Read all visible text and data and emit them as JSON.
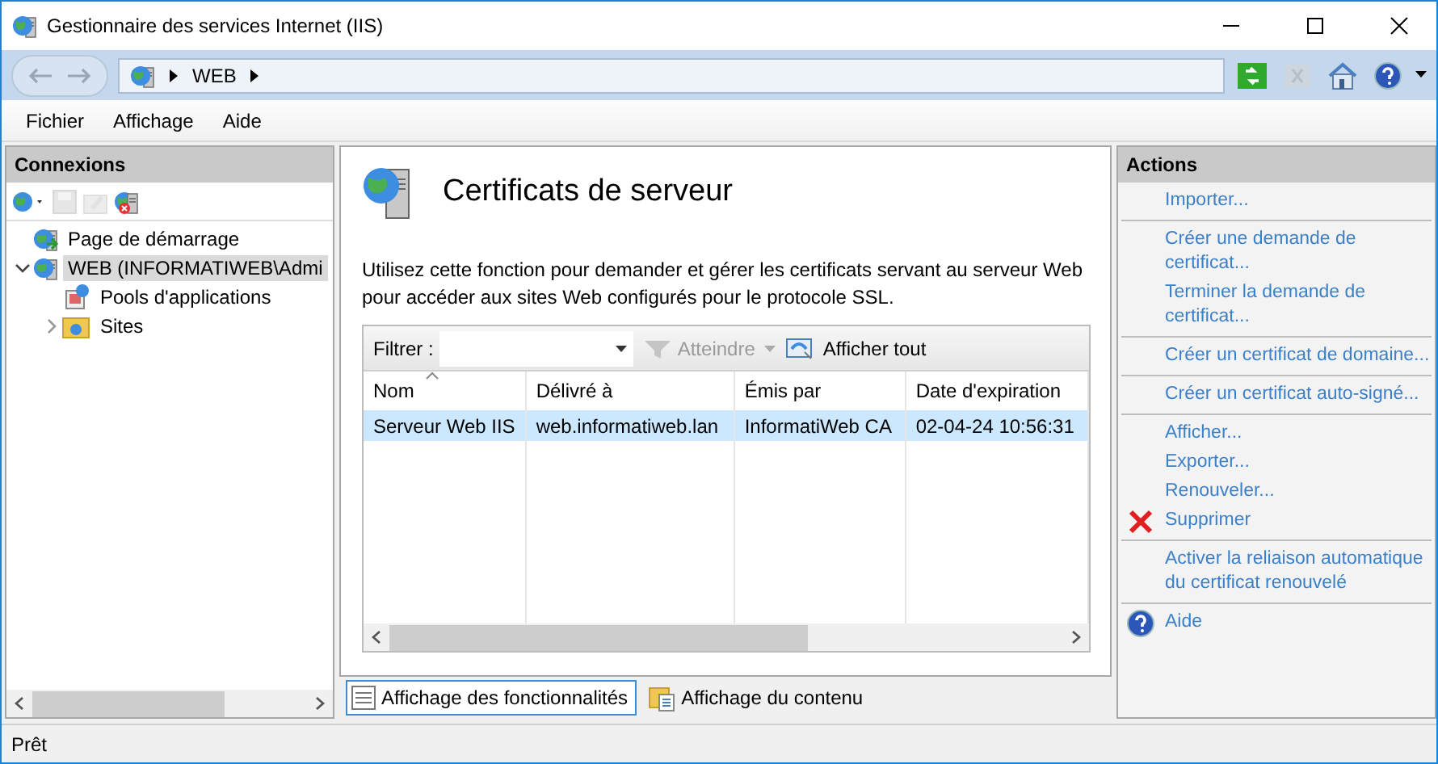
{
  "window": {
    "title": "Gestionnaire des services Internet (IIS)"
  },
  "navigation": {
    "back": {
      "disabled": true
    },
    "forward": {
      "disabled": true
    },
    "breadcrumb": [
      "WEB"
    ],
    "tools": [
      {
        "kind": "refresh",
        "disabled": false
      },
      {
        "kind": "stop",
        "disabled": true
      },
      {
        "kind": "home",
        "disabled": false
      },
      {
        "kind": "help",
        "disabled": false
      }
    ]
  },
  "menu": [
    "Fichier",
    "Affichage",
    "Aide"
  ],
  "connections": {
    "title": "Connexions",
    "tools": [
      {
        "kind": "connect",
        "disabled": false
      },
      {
        "kind": "save",
        "disabled": true
      },
      {
        "kind": "edit",
        "disabled": true
      },
      {
        "kind": "disconnect",
        "disabled": false
      }
    ],
    "tree": [
      {
        "label": "Page de démarrage",
        "kind": "start",
        "selected": false
      },
      {
        "label": "WEB (INFORMATIWEB\\Admi",
        "kind": "server",
        "selected": true,
        "expanded": true,
        "children": [
          {
            "label": "Pools d'applications",
            "kind": "pools",
            "selected": false
          },
          {
            "label": "Sites",
            "kind": "sites",
            "selected": false,
            "expanded": false
          }
        ]
      }
    ]
  },
  "feature": {
    "title": "Certificats de serveur",
    "description": "Utilisez cette fonction pour demander et gérer les certificats servant au serveur Web pour accéder aux sites Web configurés pour le protocole SSL.",
    "filter": {
      "label": "Filtrer :"
    },
    "go": {
      "label": "Atteindre",
      "disabled": true
    },
    "show_all": {
      "label": "Afficher tout"
    },
    "table": {
      "columns": [
        {
          "label": "Nom",
          "sorted": true
        },
        {
          "label": "Délivré à"
        },
        {
          "label": "Émis par"
        },
        {
          "label": "Date d'expiration"
        }
      ],
      "rows": [
        {
          "cells": [
            "Serveur Web IIS",
            "web.informatiweb.lan",
            "InformatiWeb CA",
            "02-04-24 10:56:31"
          ],
          "selected": true
        }
      ]
    }
  },
  "views": [
    {
      "label": "Affichage des fonctionnalités",
      "kind": "features",
      "selected": true
    },
    {
      "label": "Affichage du contenu",
      "kind": "content",
      "selected": false
    }
  ],
  "actions": {
    "title": "Actions",
    "groups": [
      {
        "items": [
          {
            "label": "Importer...",
            "kind": "link"
          }
        ]
      },
      {
        "items": [
          {
            "label": "Créer une demande de certificat...",
            "kind": "link"
          },
          {
            "label": "Terminer la demande de certificat...",
            "kind": "link"
          }
        ]
      },
      {
        "items": [
          {
            "label": "Créer un certificat de domaine...",
            "kind": "link"
          }
        ]
      },
      {
        "items": [
          {
            "label": "Créer un certificat auto-signé...",
            "kind": "link"
          }
        ]
      },
      {
        "items": [
          {
            "label": "Afficher...",
            "kind": "link"
          },
          {
            "label": "Exporter...",
            "kind": "link"
          },
          {
            "label": "Renouveler...",
            "kind": "link"
          },
          {
            "label": "Supprimer",
            "kind": "delete"
          }
        ]
      },
      {
        "items": [
          {
            "label": "Activer la reliaison automatique du certificat renouvelé",
            "kind": "link"
          }
        ]
      },
      {
        "items": [
          {
            "label": "Aide",
            "kind": "help"
          }
        ]
      }
    ]
  },
  "status_bar": "Prêt"
}
